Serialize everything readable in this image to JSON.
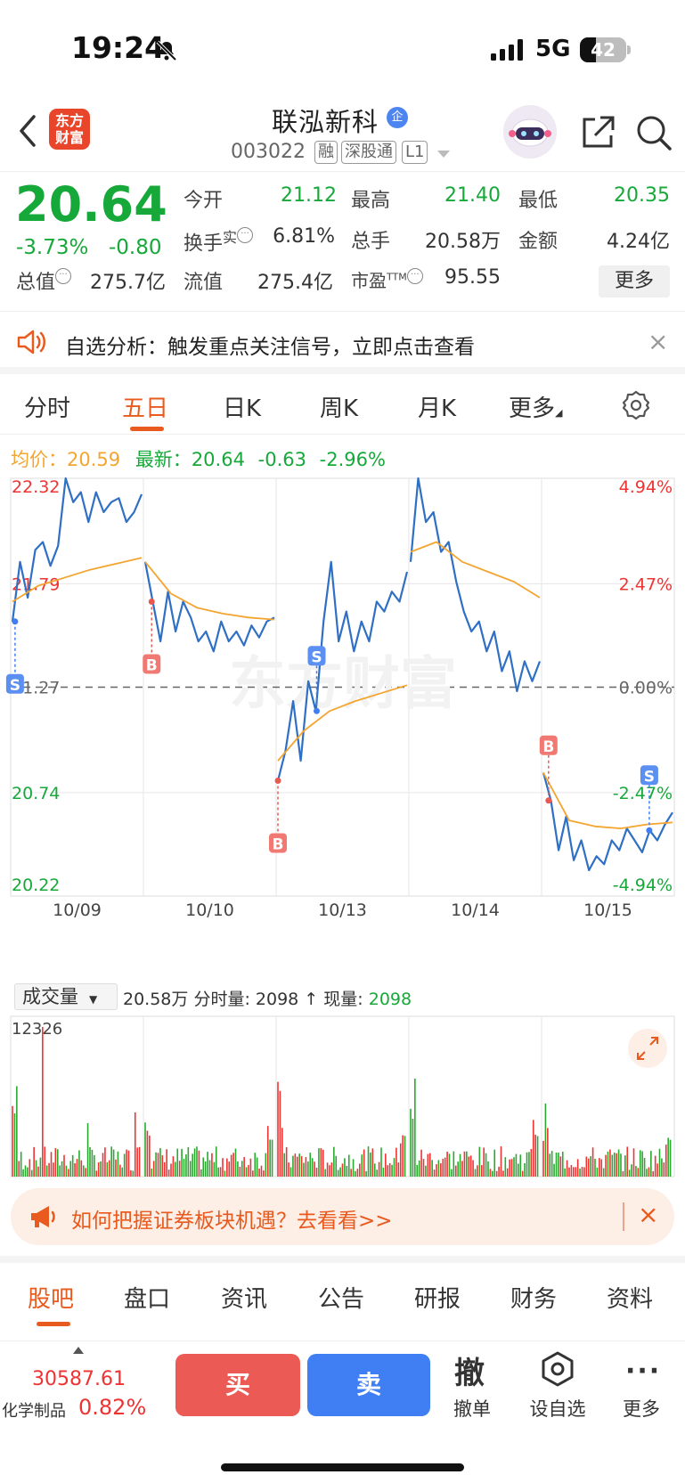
{
  "status_bar": {
    "time": "19:24",
    "network": "5G",
    "battery": "42"
  },
  "nav": {
    "logo_line1": "东方",
    "logo_line2": "财富",
    "stock_name": "联泓新科",
    "badge": "企",
    "code": "003022",
    "tags": [
      "融",
      "深股通",
      "L1"
    ]
  },
  "quote": {
    "price": "20.64",
    "change_pct": "-3.73%",
    "change": "-0.80",
    "open_label": "今开",
    "open": "21.12",
    "high_label": "最高",
    "high": "21.40",
    "low_label": "最低",
    "low": "20.35",
    "turnover_label": "换手",
    "turnover_sup": "实",
    "turnover": "6.81%",
    "volume_label": "总手",
    "volume": "20.58万",
    "amount_label": "金额",
    "amount": "4.24亿",
    "mcap_label": "总值",
    "mcap": "275.7亿",
    "float_label": "流值",
    "float": "275.4亿",
    "pe_label": "市盈",
    "pe_sup": "TTM",
    "pe": "95.55",
    "more": "更多"
  },
  "analysis": {
    "text": "自选分析：触发重点关注信号，立即点击查看"
  },
  "tabs": [
    {
      "label": "分时",
      "active": false
    },
    {
      "label": "五日",
      "active": true
    },
    {
      "label": "日K",
      "active": false
    },
    {
      "label": "周K",
      "active": false
    },
    {
      "label": "月K",
      "active": false
    },
    {
      "label": "更多",
      "active": false
    }
  ],
  "avg_row": {
    "avg_label": "均价：",
    "avg": "20.59",
    "latest_label": "最新：",
    "latest": "20.64",
    "chg": "-0.63",
    "pct": "-2.96%"
  },
  "chart_data": {
    "type": "line",
    "title": "",
    "x_days": [
      "10/09",
      "10/10",
      "10/13",
      "10/14",
      "10/15"
    ],
    "ylim": [
      20.22,
      22.32
    ],
    "y_ticks": [
      "22.32",
      "21.79",
      "21.27",
      "20.74",
      "20.22"
    ],
    "pct_ticks": [
      "4.94%",
      "2.47%",
      "0.00%",
      "-2.47%",
      "-4.94%"
    ],
    "prev_close": 21.27,
    "watermark": "东方财富",
    "series": [
      {
        "name": "最新",
        "color": "#2f6fc4",
        "day_paths": [
          [
            21.6,
            21.9,
            21.72,
            21.96,
            22.0,
            21.88,
            21.98,
            22.32,
            22.2,
            22.25,
            22.1,
            22.25,
            22.15,
            22.2,
            22.22,
            22.1,
            22.15,
            22.24
          ],
          [
            21.9,
            21.7,
            21.5,
            21.75,
            21.55,
            21.7,
            21.62,
            21.5,
            21.55,
            21.45,
            21.6,
            21.5,
            21.55,
            21.48,
            21.58,
            21.52,
            21.6,
            21.62
          ],
          [
            20.8,
            20.95,
            21.2,
            20.9,
            21.3,
            21.15,
            21.6,
            21.9,
            21.5,
            21.65,
            21.45,
            21.6,
            21.5,
            21.7,
            21.65,
            21.75,
            21.7,
            21.85
          ],
          [
            21.9,
            22.32,
            22.1,
            22.15,
            21.95,
            22.0,
            21.8,
            21.65,
            21.55,
            21.6,
            21.45,
            21.55,
            21.35,
            21.45,
            21.25,
            21.4,
            21.3,
            21.4
          ],
          [
            20.84,
            20.7,
            20.45,
            20.62,
            20.4,
            20.5,
            20.35,
            20.42,
            20.38,
            20.5,
            20.45,
            20.56,
            20.5,
            20.44,
            20.55,
            20.5,
            20.58,
            20.64
          ]
        ]
      },
      {
        "name": "均价",
        "color": "#f3a530",
        "day_paths": [
          [
            21.7,
            21.78,
            21.82,
            21.86,
            21.89,
            21.92
          ],
          [
            21.9,
            21.74,
            21.67,
            21.64,
            21.62,
            21.61
          ],
          [
            20.9,
            21.05,
            21.15,
            21.2,
            21.24,
            21.28
          ],
          [
            21.95,
            22.0,
            21.9,
            21.85,
            21.8,
            21.72
          ],
          [
            20.84,
            20.6,
            20.57,
            20.56,
            20.58,
            20.59
          ]
        ]
      }
    ],
    "markers": [
      {
        "label": "S",
        "day": 0,
        "pos": 0.02,
        "side": "below"
      },
      {
        "label": "B",
        "day": 1,
        "pos": 0.05,
        "side": "below"
      },
      {
        "label": "S",
        "day": 2,
        "pos": 0.3,
        "side": "above"
      },
      {
        "label": "B",
        "day": 2,
        "pos": 0.0,
        "side": "below"
      },
      {
        "label": "B",
        "day": 4,
        "pos": 0.04,
        "side": "above"
      },
      {
        "label": "S",
        "day": 4,
        "pos": 0.82,
        "side": "above"
      }
    ]
  },
  "volume": {
    "selector": "成交量",
    "total": "20.58万",
    "minute_label": "分时量:",
    "minute": "2098",
    "arrow": "↑",
    "now_label": "现量:",
    "now": "2098",
    "max": "12326"
  },
  "banner": {
    "text": "如何把握证券板块机遇？去看看>>"
  },
  "bottom_tabs": [
    "股吧",
    "盘口",
    "资讯",
    "公告",
    "研报",
    "财务",
    "资料"
  ],
  "toolbar": {
    "index_value": "30587.61",
    "index_name": "化学制品",
    "index_pct": "0.82%",
    "buy": "买",
    "sell": "卖",
    "cancel_icon": "撤",
    "cancel": "撤单",
    "watch": "设自选",
    "more": "更多"
  }
}
